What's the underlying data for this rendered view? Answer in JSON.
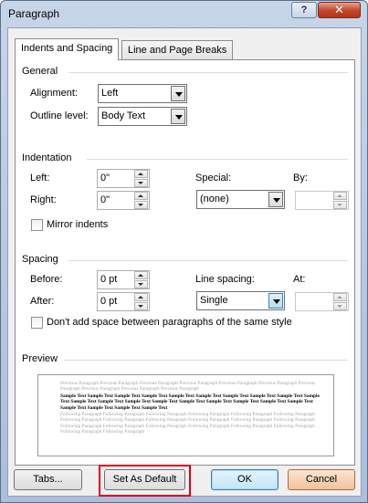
{
  "window": {
    "title": "Paragraph",
    "help_label": "?",
    "close_label": "✕"
  },
  "tabs": [
    {
      "label": "Indents and Spacing",
      "active": true
    },
    {
      "label": "Line and Page Breaks",
      "active": false
    }
  ],
  "general": {
    "heading": "General",
    "alignment_label": "Alignment:",
    "alignment_value": "Left",
    "outline_label": "Outline level:",
    "outline_value": "Body Text"
  },
  "indentation": {
    "heading": "Indentation",
    "left_label": "Left:",
    "left_value": "0\"",
    "right_label": "Right:",
    "right_value": "0\"",
    "special_label": "Special:",
    "special_value": "(none)",
    "by_label": "By:",
    "by_value": "",
    "mirror_label": "Mirror indents"
  },
  "spacing": {
    "heading": "Spacing",
    "before_label": "Before:",
    "before_value": "0 pt",
    "after_label": "After:",
    "after_value": "0 pt",
    "line_spacing_label": "Line spacing:",
    "line_spacing_value": "Single",
    "at_label": "At:",
    "at_value": "",
    "dont_add_label": "Don't add space between paragraphs of the same style"
  },
  "preview": {
    "heading": "Preview",
    "previous_text": "Previous Paragraph Previous Paragraph Previous Paragraph Previous Paragraph Previous Paragraph Previous Paragraph Previous Paragraph Previous Paragraph Previous Paragraph Previous Paragraph",
    "sample_text": "Sample Text Sample Text Sample Text Sample Text Sample Text Sample Text Sample Text Sample Text Sample Text Sample Text Sample Text Sample Text Sample Text Sample Text Sample Text Sample Text Sample Text Sample Text Sample Text Sample Text Sample Text Sample Text Sample Text",
    "following_text": "Following Paragraph Following Paragraph Following Paragraph Following Paragraph Following Paragraph Following Paragraph Following Paragraph Following Paragraph Following Paragraph Following Paragraph Following Paragraph Following Paragraph Following Paragraph Following Paragraph Following Paragraph Following Paragraph Following Paragraph Following Paragraph Following Paragraph Following Paragraph"
  },
  "buttons": {
    "tabs": "Tabs...",
    "set_default": "Set As Default",
    "ok": "OK",
    "cancel": "Cancel"
  },
  "colors": {
    "highlight": "#e0001b",
    "ok_border": "#3c7fb1",
    "close_red": "#c2432a"
  }
}
